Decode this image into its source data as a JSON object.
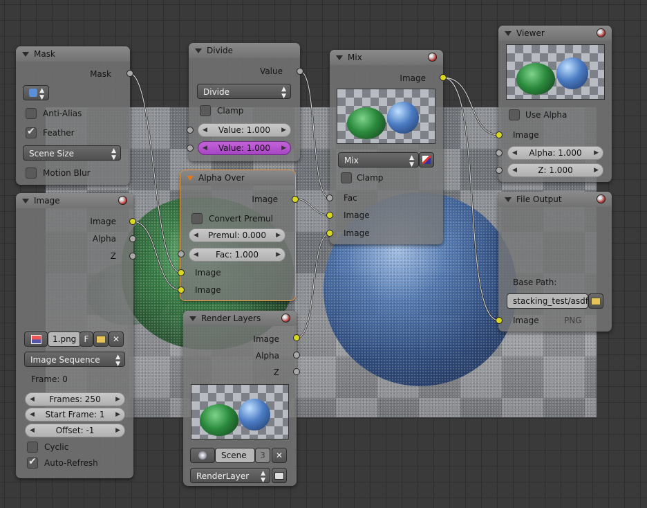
{
  "nodes": {
    "mask": {
      "title": "Mask",
      "output_mask": "Mask",
      "anti_alias": "Anti-Alias",
      "feather": "Feather",
      "size_select": "Scene Size",
      "motion_blur": "Motion Blur"
    },
    "image": {
      "title": "Image",
      "out_image": "Image",
      "out_alpha": "Alpha",
      "out_z": "Z",
      "file_name": "1.png",
      "fake_user": "F",
      "source_select": "Image Sequence",
      "frame_label": "Frame: 0",
      "frames": "Frames: 250",
      "start_frame": "Start Frame: 1",
      "offset": "Offset: -1",
      "cyclic": "Cyclic",
      "auto_refresh": "Auto-Refresh"
    },
    "divide": {
      "title": "Divide",
      "out_value": "Value",
      "operation": "Divide",
      "clamp": "Clamp",
      "value1": "Value: 1.000",
      "value2": "Value: 1.000"
    },
    "alpha_over": {
      "title": "Alpha Over",
      "out_image": "Image",
      "convert_premul": "Convert Premul",
      "premul": "Premul: 0.000",
      "fac": "Fac: 1.000",
      "in_image1": "Image",
      "in_image2": "Image"
    },
    "render_layers": {
      "title": "Render Layers",
      "out_image": "Image",
      "out_alpha": "Alpha",
      "out_z": "Z",
      "scene": "Scene",
      "scene_users": "3",
      "layer": "RenderLayer"
    },
    "mix": {
      "title": "Mix",
      "out_image": "Image",
      "blend_mode": "Mix",
      "clamp": "Clamp",
      "in_fac": "Fac",
      "in_image1": "Image",
      "in_image2": "Image"
    },
    "viewer": {
      "title": "Viewer",
      "use_alpha": "Use Alpha",
      "in_image": "Image",
      "alpha": "Alpha: 1.000",
      "z": "Z: 1.000"
    },
    "file_output": {
      "title": "File Output",
      "base_path_label": "Base Path:",
      "base_path": "stacking_test/asdf/",
      "in_image": "Image",
      "format": "PNG"
    }
  },
  "colors": {
    "socket_color": "#d8d822",
    "socket_value": "#a9a9a9",
    "active_outline": "#e59a3b",
    "purple_slider": "#b050cc"
  },
  "icons": {
    "node_preview": "material-ball-icon",
    "folder": "folder-icon",
    "close": "close-x-icon",
    "mask_datablock": "mask-icon",
    "image_datablock": "image-icon",
    "scene_datablock": "scene-icon",
    "render": "render-camera-icon",
    "color_picker": "color-ramp-icon"
  }
}
